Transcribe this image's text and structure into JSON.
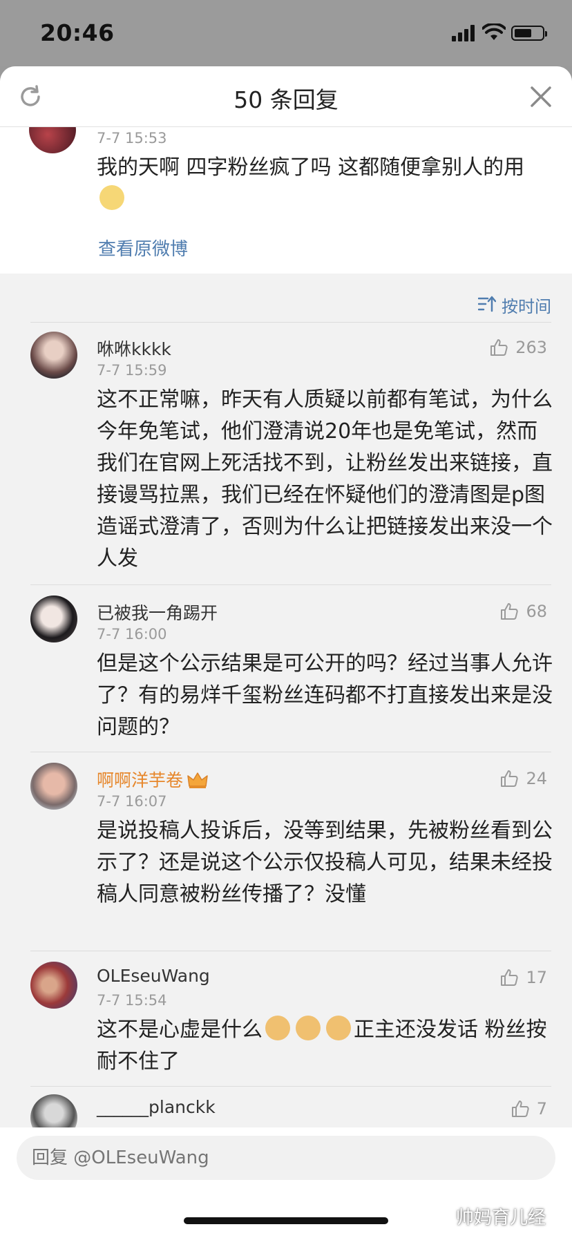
{
  "status_bar": {
    "time": "20:46",
    "signal_icon": "cellular-signal-icon",
    "wifi_icon": "wifi-icon",
    "battery_icon": "battery-icon"
  },
  "header": {
    "title": "50 条回复",
    "refresh_icon": "refresh-icon",
    "close_icon": "close-icon"
  },
  "top_comment": {
    "time": "7-7 15:53",
    "text": "我的天啊  四字粉丝疯了吗  这都随便拿别人的用",
    "emoji": "eye-roll-emoji",
    "link": "查看原微博"
  },
  "sort": {
    "label": "按时间",
    "icon": "sort-icon"
  },
  "comments": [
    {
      "name": "咻咻kkkk",
      "time": "7-7 15:59",
      "likes": "263",
      "text": "这不正常嘛，昨天有人质疑以前都有笔试，为什么今年免笔试，他们澄清说20年也是免笔试，然而我们在官网上死活找不到，让粉丝发出来链接，直接谩骂拉黑，我们已经在怀疑他们的澄清图是p图造谣式澄清了，否则为什么让把链接发出来没一个人发"
    },
    {
      "name": "已被我一角踢开",
      "time": "7-7 16:00",
      "likes": "68",
      "text": "但是这个公示结果是可公开的吗？经过当事人允许了？有的易烊千玺粉丝连码都不打直接发出来是没问题的？"
    },
    {
      "name": "啊啊洋芋卷",
      "time": "7-7 16:07",
      "likes": "24",
      "badge": "crown-icon",
      "text": "是说投稿人投诉后，没等到结果，先被粉丝看到公示了？还是说这个公示仅投稿人可见，结果未经投稿人同意被粉丝传播了？没懂"
    },
    {
      "name": "OLEseuWang",
      "time": "7-7 15:54",
      "likes": "17",
      "text_before": "这不是心虚是什么",
      "text_after": "正主还没发话 粉丝按耐不住了",
      "emoji": "doge-emoji"
    },
    {
      "name": "______planckk",
      "likes": "7"
    }
  ],
  "reply": {
    "placeholder": "回复 @OLEseuWang"
  },
  "watermark": "帅妈育儿经",
  "colors": {
    "link": "#507daf",
    "vip_name": "#e6862a",
    "muted": "#9a9a9a"
  }
}
